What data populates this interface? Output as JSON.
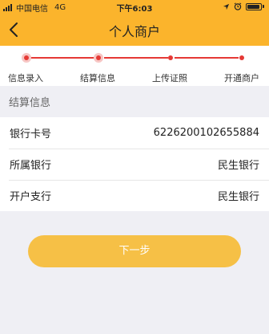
{
  "status_bar": {
    "carrier": "中国电信",
    "network": "4G",
    "time": "下午6:03"
  },
  "nav": {
    "title": "个人商户",
    "back_icon": "chevron-left-icon"
  },
  "steps": [
    {
      "label": "信息录入"
    },
    {
      "label": "结算信息"
    },
    {
      "label": "上传证照"
    },
    {
      "label": "开通商户"
    }
  ],
  "section": {
    "title": "结算信息"
  },
  "rows": [
    {
      "label": "银行卡号",
      "value": "6226200102655884"
    },
    {
      "label": "所属银行",
      "value": "民生银行"
    },
    {
      "label": "开户支行",
      "value": "民生银行"
    }
  ],
  "next_button": {
    "label": "下一步"
  },
  "colors": {
    "header": "#fbb42c",
    "progress": "#e53935",
    "button": "#f6c046",
    "background": "#efeff4"
  }
}
